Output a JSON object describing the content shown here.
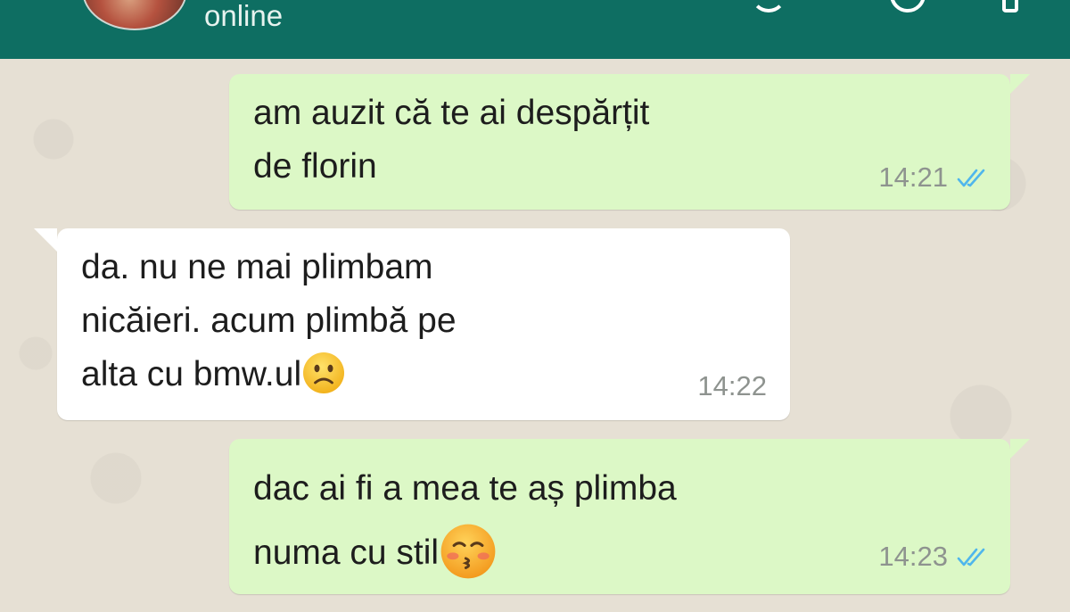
{
  "header": {
    "status": "online",
    "background_color": "#0e6e62"
  },
  "messages": [
    {
      "direction": "outgoing",
      "lines": [
        "am auzit că te ai despărțit",
        "de florin"
      ],
      "time": "14:21",
      "read_ticks": "double-blue-check-icon"
    },
    {
      "direction": "incoming",
      "lines": [
        "da. nu ne mai plimbam",
        "nicăieri. acum plimbă pe",
        "alta cu bmw.ul"
      ],
      "emoji": "slightly-frowning-face-emoji",
      "time": "14:22"
    },
    {
      "direction": "outgoing",
      "lines": [
        "dac ai fi a mea te aș plimba",
        "numa cu stil"
      ],
      "emoji": "kissing-face-closed-eyes-emoji",
      "time": "14:23",
      "read_ticks": "double-blue-check-icon"
    }
  ],
  "colors": {
    "outgoing_bubble": "#dcf8c6",
    "incoming_bubble": "#ffffff",
    "chat_background": "#e6e0d4",
    "read_tick": "#4fb6ec",
    "timestamp": "#8e938f"
  }
}
